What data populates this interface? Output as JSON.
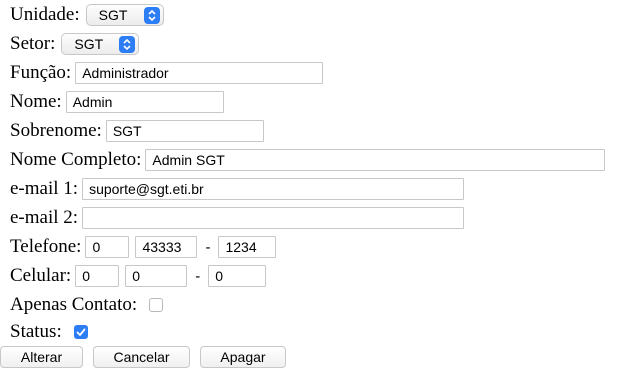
{
  "form": {
    "unidade": {
      "label": "Unidade:",
      "value": "SGT"
    },
    "setor": {
      "label": "Setor:",
      "value": "SGT"
    },
    "funcao": {
      "label": "Função:",
      "value": "Administrador"
    },
    "nome": {
      "label": "Nome:",
      "value": "Admin"
    },
    "sobrenome": {
      "label": "Sobrenome:",
      "value": "SGT"
    },
    "nome_completo": {
      "label": "Nome Completo:",
      "value": "Admin SGT"
    },
    "email1": {
      "label": "e-mail 1:",
      "value": "suporte@sgt.eti.br"
    },
    "email2": {
      "label": "e-mail 2:",
      "value": ""
    },
    "telefone": {
      "label": "Telefone:",
      "ddd": "0",
      "prefix": "43333",
      "separator": "-",
      "suffix": "1234"
    },
    "celular": {
      "label": "Celular:",
      "ddd": "0",
      "prefix": "0",
      "separator": "-",
      "suffix": "0"
    },
    "apenas_contato": {
      "label": "Apenas Contato:",
      "checked": false
    },
    "status": {
      "label": "Status:",
      "checked": true
    }
  },
  "buttons": {
    "alterar": "Alterar",
    "cancelar": "Cancelar",
    "apagar": "Apagar"
  },
  "colors": {
    "accent": "#2d7df6",
    "border": "#c8c8c8"
  }
}
